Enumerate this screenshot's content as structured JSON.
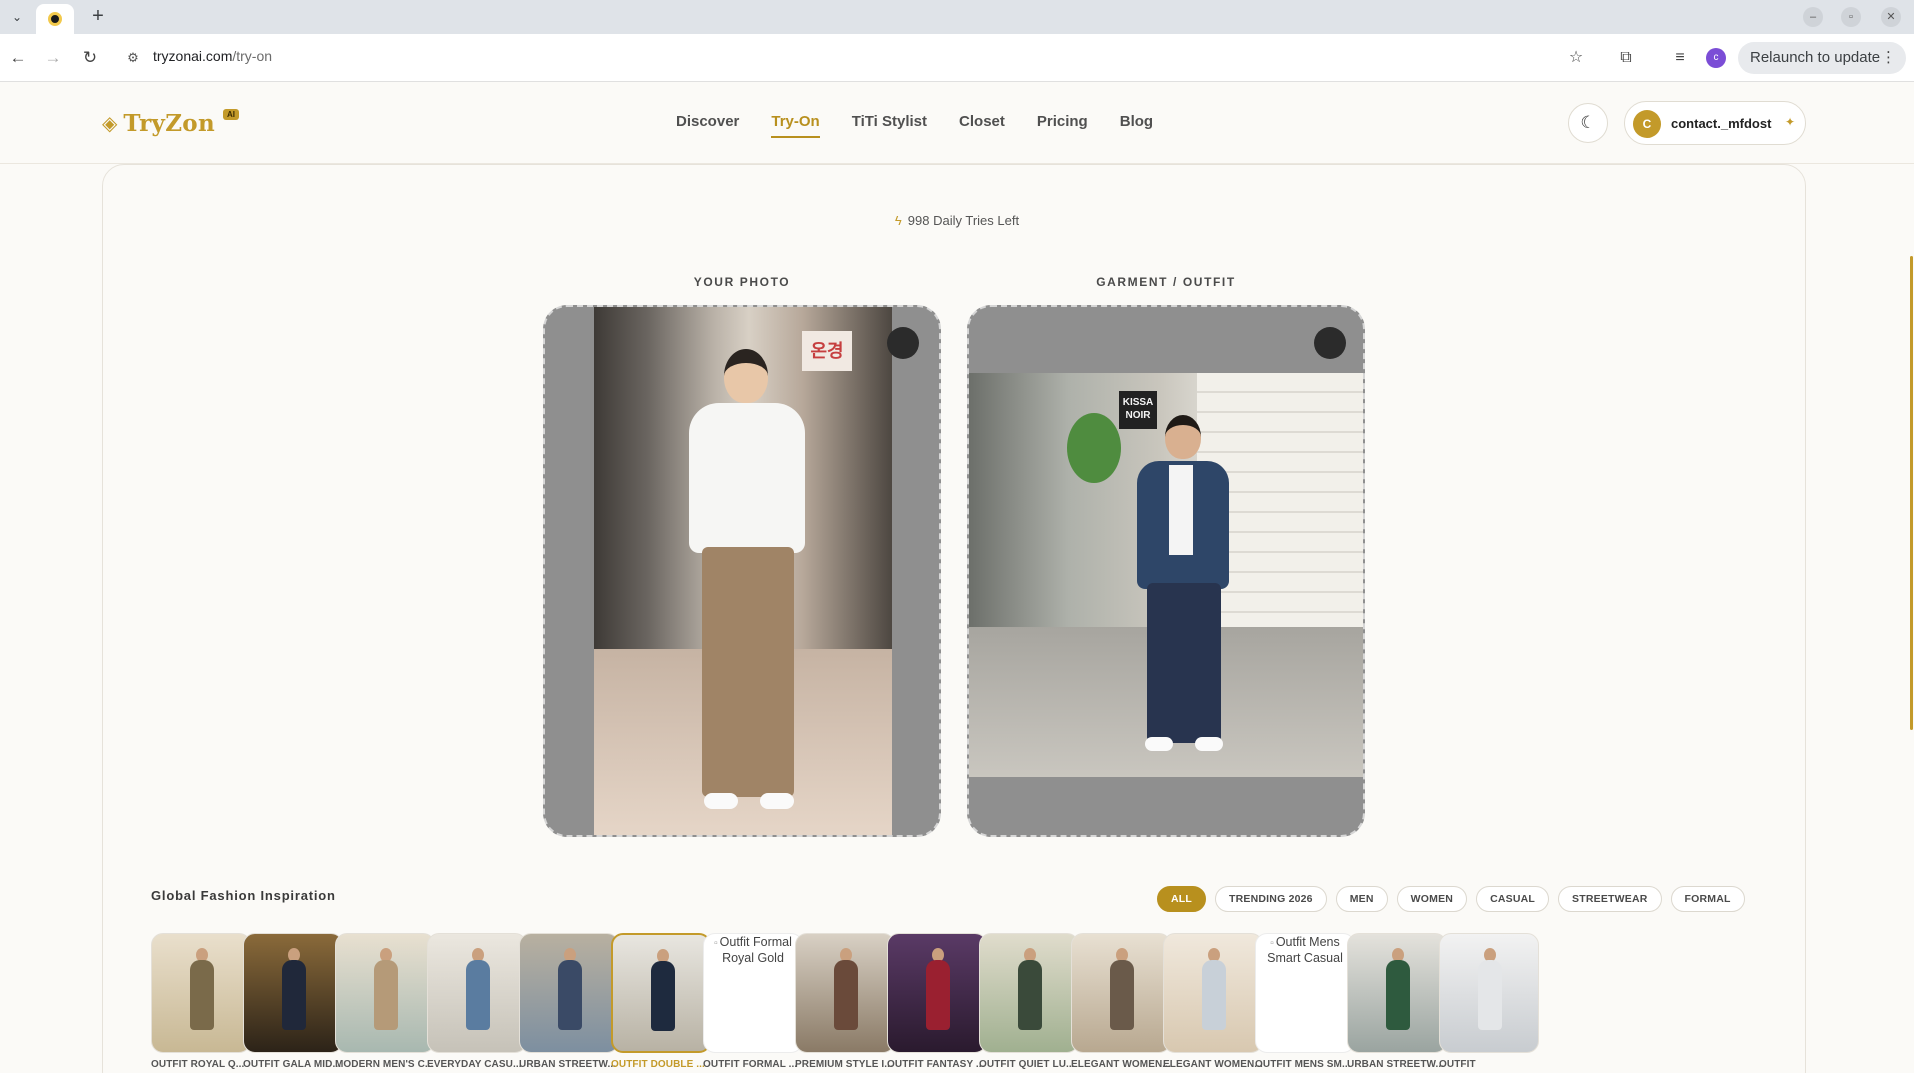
{
  "browser": {
    "url_host": "tryzonai.com",
    "url_path": "/try-on",
    "relaunch_label": "Relaunch to update",
    "profile_initial": "c"
  },
  "header": {
    "logo_text": "TryZon",
    "logo_badge": "AI",
    "nav": [
      "Discover",
      "Try-On",
      "TiTi Stylist",
      "Closet",
      "Pricing",
      "Blog"
    ],
    "active_nav": "Try-On",
    "user_initial": "C",
    "user_name": "contact._mfdost"
  },
  "tryon": {
    "tries_left": "998 Daily Tries Left",
    "your_photo_label": "YOUR PHOTO",
    "garment_label": "GARMENT / OUTFIT",
    "sign_text_1": "온경",
    "sign_text_2": "KISSA NOIR"
  },
  "inspiration": {
    "title": "Global Fashion Inspiration",
    "filters": [
      "ALL",
      "TRENDING 2026",
      "MEN",
      "WOMEN",
      "CASUAL",
      "STREETWEAR",
      "FORMAL"
    ],
    "active_filter": "ALL",
    "items": [
      {
        "label": "OUTFIT ROYAL Q...",
        "alt": ""
      },
      {
        "label": "OUTFIT GALA MID...",
        "alt": ""
      },
      {
        "label": "MODERN MEN'S C...",
        "alt": ""
      },
      {
        "label": "EVERYDAY CASU...",
        "alt": ""
      },
      {
        "label": "URBAN STREETW...",
        "alt": ""
      },
      {
        "label": "OUTFIT DOUBLE ...",
        "alt": ""
      },
      {
        "label": "OUTFIT FORMAL ...",
        "alt": "Outfit Formal Royal Gold"
      },
      {
        "label": "PREMIUM STYLE I...",
        "alt": ""
      },
      {
        "label": "OUTFIT FANTASY ...",
        "alt": ""
      },
      {
        "label": "OUTFIT QUIET LU...",
        "alt": ""
      },
      {
        "label": "ELEGANT WOMEN...",
        "alt": ""
      },
      {
        "label": "ELEGANT WOMEN...",
        "alt": ""
      },
      {
        "label": "OUTFIT MENS SM...",
        "alt": "Outfit Mens Smart Casual"
      },
      {
        "label": "URBAN STREETW...",
        "alt": ""
      },
      {
        "label": "OUTFIT",
        "alt": ""
      }
    ],
    "selected_index": 5
  },
  "colors": {
    "accent": "#b8901e",
    "background": "#fbfaf7"
  }
}
